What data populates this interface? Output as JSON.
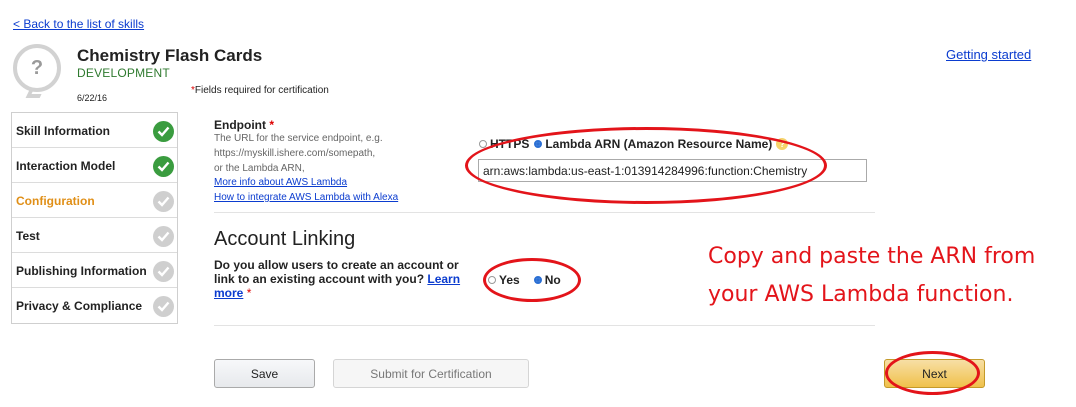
{
  "header": {
    "back_link": "< Back to the list of skills",
    "skill_name": "Chemistry Flash Cards",
    "skill_status": "DEVELOPMENT",
    "date": "6/22/16",
    "required_star": "*",
    "required_note": "Fields required for certification",
    "getting_started": "Getting started",
    "icon_glyph": "?"
  },
  "sidebar": {
    "items": [
      {
        "label": "Skill Information",
        "state": "complete"
      },
      {
        "label": "Interaction Model",
        "state": "complete"
      },
      {
        "label": "Configuration",
        "state": "active"
      },
      {
        "label": "Test",
        "state": "incomplete"
      },
      {
        "label": "Publishing Information",
        "state": "incomplete"
      },
      {
        "label": "Privacy & Compliance",
        "state": "incomplete"
      }
    ]
  },
  "endpoint": {
    "label": "Endpoint",
    "star": "*",
    "help_lines": [
      "The URL for the service endpoint, e.g.",
      "https://myskill.ishere.com/somepath,",
      "or the Lambda ARN,"
    ],
    "link_lambda_info": "More info about AWS Lambda",
    "link_integrate": "How to integrate AWS Lambda with Alexa",
    "option_https": "HTTPS",
    "option_lambda": "Lambda ARN (Amazon Resource Name)",
    "selected": "Lambda ARN (Amazon Resource Name)",
    "help_glyph": "?",
    "arn_value": "arn:aws:lambda:us-east-1:013914284996:function:Chemistry"
  },
  "account_linking": {
    "heading": "Account Linking",
    "question": "Do you allow users to create an account or link to an existing account with you?",
    "learn_more": "Learn more",
    "star": "*",
    "option_yes": "Yes",
    "option_no": "No",
    "selected": "No"
  },
  "annotation": {
    "line1": "Copy and paste the ARN from",
    "line2": "your AWS Lambda function."
  },
  "buttons": {
    "save": "Save",
    "submit": "Submit for Certification",
    "next": "Next"
  },
  "colors": {
    "link": "#0b3ccf",
    "status_green": "#2f7a2f",
    "check_green": "#3a9c3f",
    "active_orange": "#e08f17",
    "annotation_red": "#e3141a",
    "next_yellow": "#f0c14b"
  }
}
